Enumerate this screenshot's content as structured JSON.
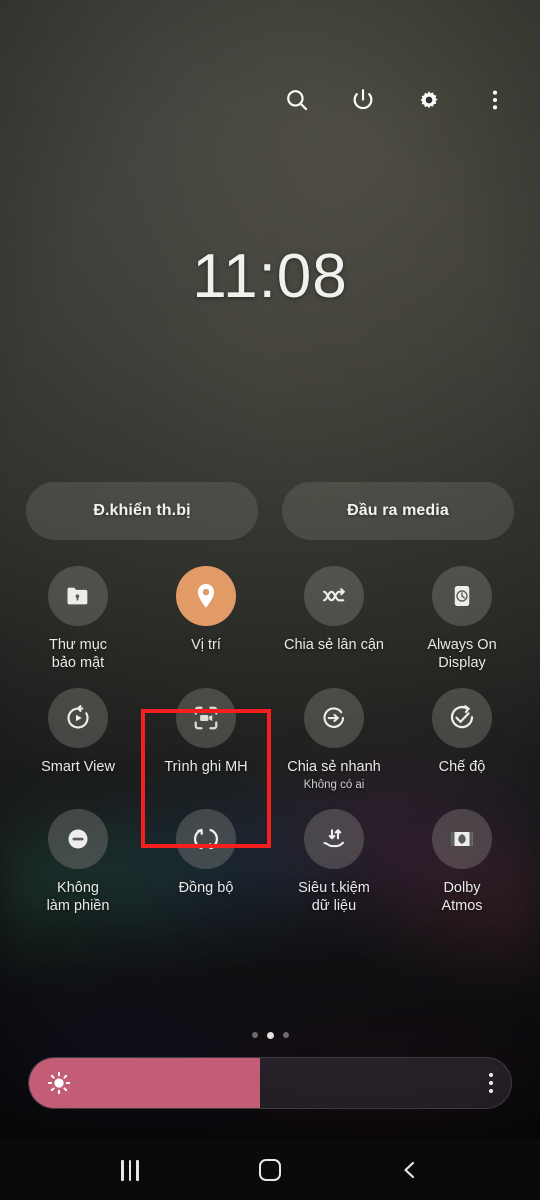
{
  "statusbar": {
    "icons": [
      {
        "name": "search-icon",
        "label": "Search"
      },
      {
        "name": "power-icon",
        "label": "Power"
      },
      {
        "name": "gear-icon",
        "label": "Settings"
      },
      {
        "name": "more-vertical-icon",
        "label": "More options"
      }
    ]
  },
  "clock": {
    "time": "11:08"
  },
  "pills": {
    "device_control": "Đ.khiển th.bị",
    "media_output": "Đầu ra media"
  },
  "toggles": {
    "row1": [
      {
        "label": "Thư mục\nbảo mật",
        "icon": "secure-folder-icon",
        "active": false
      },
      {
        "label": "Vị trí",
        "icon": "location-pin-icon",
        "active": true
      },
      {
        "label": "Chia sẻ lân cận",
        "icon": "nearby-share-icon",
        "active": false
      },
      {
        "label": "Always On\nDisplay",
        "icon": "always-on-display-icon",
        "active": false
      }
    ],
    "row2": [
      {
        "label": "Smart View",
        "icon": "smart-view-icon",
        "active": false
      },
      {
        "label": "Trình ghi MH",
        "icon": "screen-recorder-icon",
        "active": false,
        "highlighted": true
      },
      {
        "label": "Chia sẻ nhanh",
        "sublabel": "Không có ai",
        "icon": "quick-share-icon",
        "active": false
      },
      {
        "label": "Chế độ",
        "icon": "modes-icon",
        "active": false
      }
    ],
    "row3": [
      {
        "label": "Không\nlàm phiền",
        "icon": "do-not-disturb-icon",
        "active": false
      },
      {
        "label": "Đồng bộ",
        "icon": "sync-icon",
        "active": false
      },
      {
        "label": "Siêu t.kiệm\ndữ liệu",
        "icon": "ultra-data-saving-icon",
        "active": false
      },
      {
        "label": "Dolby\nAtmos",
        "icon": "dolby-atmos-icon",
        "active": false
      }
    ]
  },
  "page_indicator": {
    "total": 3,
    "active_index": 1
  },
  "brightness": {
    "level_percent": 48,
    "icon": "brightness-sun-icon",
    "menu_icon": "more-vertical-icon"
  },
  "navbar": {
    "recents": "Recents",
    "home": "Home",
    "back": "Back"
  },
  "annotation": {
    "highlight_color": "#f42020",
    "target": "Trình ghi MH"
  },
  "colors": {
    "accent_active": "#e29a67",
    "brightness_fill": "#c35c75",
    "background": "#2d302e",
    "tile_circle": "rgba(150,148,142,0.34)"
  }
}
